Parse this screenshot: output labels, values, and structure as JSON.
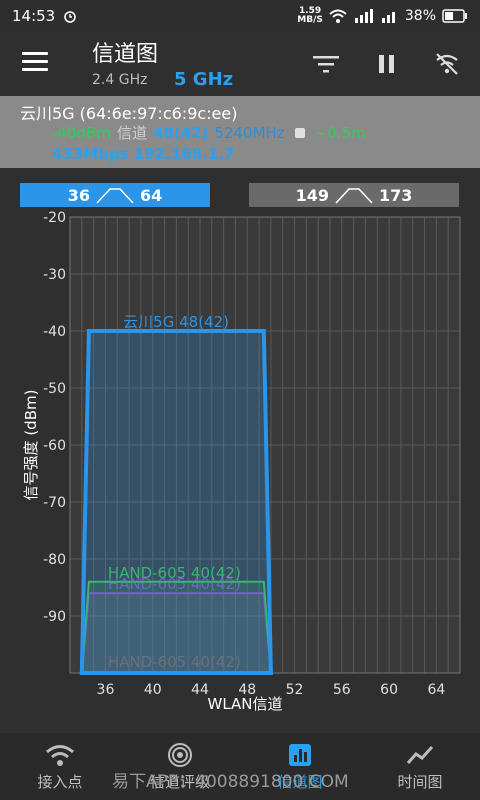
{
  "status": {
    "time": "14:53",
    "speed_value": "1.59",
    "speed_unit": "MB/S",
    "battery": "38%"
  },
  "app": {
    "title": "信道图",
    "band_24": "2.4 GHz",
    "band_5": "5 GHz"
  },
  "info": {
    "ssid_mac": "云川5G (64:6e:97:c6:9c:ee)",
    "signal": "-40dBm",
    "channel_label": "信道",
    "channel": "48(42)",
    "frequency": "5240MHz",
    "distance": "~0.5m",
    "rate_ip": "433Mbps 192.168.1.7"
  },
  "channel_tabs": [
    {
      "from": "36",
      "to": "64",
      "active": true
    },
    {
      "from": "149",
      "to": "173",
      "active": false
    }
  ],
  "chart_data": {
    "type": "area",
    "xlabel": "WLAN信道",
    "ylabel": "信号强度 (dBm)",
    "xlim": [
      33,
      66
    ],
    "ylim": [
      -100,
      -20
    ],
    "x_ticks": [
      36,
      40,
      44,
      48,
      52,
      56,
      60,
      64
    ],
    "y_ticks": [
      -20,
      -30,
      -40,
      -50,
      -60,
      -70,
      -80,
      -90
    ],
    "series": [
      {
        "name": "云川5G 48(42)",
        "from": 34,
        "to": 50,
        "level": -40,
        "color": "#2b95ea"
      },
      {
        "name": "HAND-605 40(42)",
        "from": 34,
        "to": 50,
        "level": -84,
        "color": "#3fbf4a"
      },
      {
        "name": "HAND-605 40(42)",
        "from": 34,
        "to": 50,
        "level": -86,
        "color": "#9c3fd0"
      },
      {
        "name": "HAND-605 40(42)",
        "from": 34,
        "to": 50,
        "level": -100,
        "color": "#8a5a3a"
      }
    ]
  },
  "nav": {
    "items": [
      "接入点",
      "信道评级",
      "信道图",
      "时间图"
    ],
    "active": "信道图"
  },
  "watermark": "易下APP：4008891800.COM"
}
